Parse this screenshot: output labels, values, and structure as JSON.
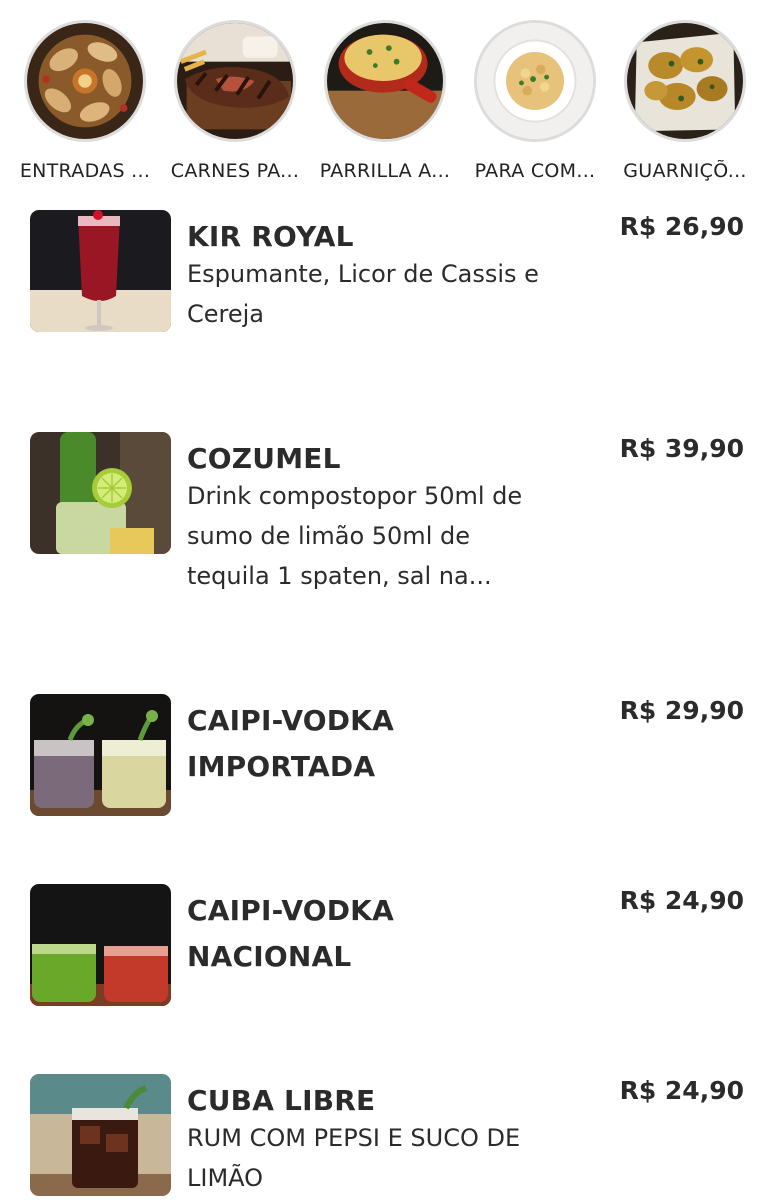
{
  "categories": [
    {
      "label": "ENTRADAS ...",
      "icon": "appetizers-image"
    },
    {
      "label": "CARNES PA...",
      "icon": "grilled-meat-image"
    },
    {
      "label": "PARRILLA A...",
      "icon": "cheese-pan-image"
    },
    {
      "label": "PARA COM...",
      "icon": "pasta-dish-image"
    },
    {
      "label": "GUARNIÇÕ...",
      "icon": "potatoes-image"
    }
  ],
  "items": [
    {
      "name": "KIR ROYAL",
      "desc": "Espumante, Licor de Cassis e Cereja",
      "price": "R$ 26,90"
    },
    {
      "name": "COZUMEL",
      "desc": "Drink compostopor 50ml de sumo de limão 50ml de tequila 1 spaten, sal na...",
      "price": "R$ 39,90"
    },
    {
      "name": "CAIPI-VODKA IMPORTADA",
      "desc": "",
      "price": "R$ 29,90"
    },
    {
      "name": "CAIPI-VODKA NACIONAL",
      "desc": "",
      "price": "R$ 24,90"
    },
    {
      "name": "CUBA LIBRE",
      "desc": "RUM COM PEPSI E SUCO DE LIMÃO",
      "price": "R$ 24,90"
    }
  ]
}
